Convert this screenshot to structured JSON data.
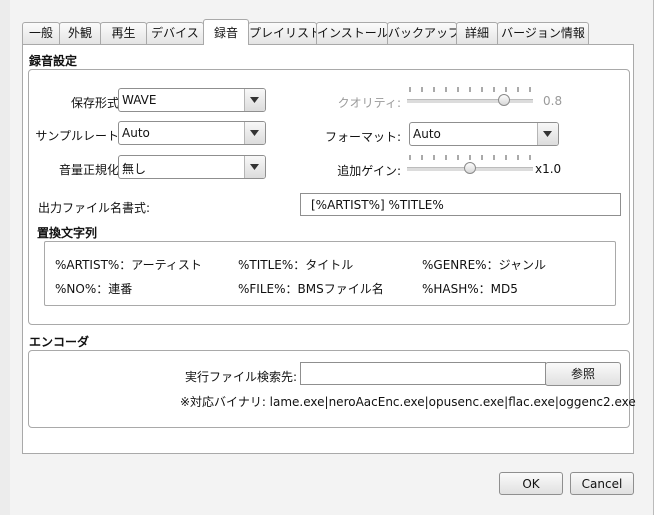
{
  "tabs": [
    {
      "label": "一般"
    },
    {
      "label": "外観"
    },
    {
      "label": "再生"
    },
    {
      "label": "デバイス"
    },
    {
      "label": "録音",
      "active": true
    },
    {
      "label": "プレイリスト"
    },
    {
      "label": "インストール"
    },
    {
      "label": "バックアップ"
    },
    {
      "label": "詳細"
    },
    {
      "label": "バージョン情報"
    }
  ],
  "recording": {
    "section_title": "録音設定",
    "save_format": {
      "label": "保存形式:",
      "value": "WAVE"
    },
    "sample_rate": {
      "label": "サンプルレート:",
      "value": "Auto"
    },
    "normalize": {
      "label": "音量正規化:",
      "value": "無し"
    },
    "quality": {
      "label": "クオリティ:",
      "value": "0.8",
      "level": 0.8,
      "enabled": false
    },
    "format": {
      "label": "フォーマット:",
      "value": "Auto"
    },
    "gain": {
      "label": "追加ゲイン:",
      "value": "x1.0",
      "level": 0.5
    },
    "output_name": {
      "label": "出力ファイル名書式:",
      "value": "[%ARTIST%] %TITLE%"
    }
  },
  "replace": {
    "title": "置換文字列",
    "items": [
      "%ARTIST%：アーティスト",
      "%TITLE%：タイトル",
      "%GENRE%：ジャンル",
      "%NO%：連番",
      "%FILE%：BMSファイル名",
      "%HASH%：MD5"
    ]
  },
  "encoder": {
    "section_title": "エンコーダ",
    "exe_label": "実行ファイル検索先:",
    "exe_value": "",
    "browse_label": "参照",
    "note": "※対応バイナリ: lame.exe|neroAacEnc.exe|opusenc.exe|flac.exe|oggenc2.exe"
  },
  "footer": {
    "ok_label": "OK",
    "cancel_label": "Cancel"
  }
}
